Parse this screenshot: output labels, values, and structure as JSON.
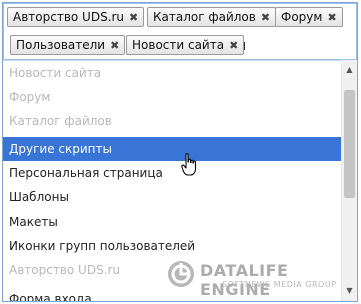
{
  "selected_tags": [
    {
      "label": "Авторство UDS.ru",
      "remove_glyph": "✖"
    },
    {
      "label": "Каталог файлов",
      "remove_glyph": "✖"
    },
    {
      "label": "Форум",
      "remove_glyph": "✖"
    },
    {
      "label": "Пользователи",
      "remove_glyph": "✖"
    },
    {
      "label": "Новости сайта",
      "remove_glyph": "✖"
    }
  ],
  "search_input": {
    "value": "",
    "placeholder": ""
  },
  "options": [
    {
      "label": "Новости сайта",
      "state": "disabled"
    },
    {
      "label": "Форум",
      "state": "disabled"
    },
    {
      "label": "Каталог файлов",
      "state": "disabled"
    },
    {
      "label": "Другие скрипты",
      "state": "highlighted"
    },
    {
      "label": "Персональная страница",
      "state": "normal"
    },
    {
      "label": "Шаблоны",
      "state": "normal"
    },
    {
      "label": "Макеты",
      "state": "normal"
    },
    {
      "label": "Иконки групп пользователей",
      "state": "normal"
    },
    {
      "label": "Авторство UDS.ru",
      "state": "disabled"
    },
    {
      "label": "Форма входа",
      "state": "normal"
    }
  ],
  "watermark": {
    "title": "DATALIFE ENGINE",
    "subtitle": "SOFTNEWS MEDIA GROUP"
  },
  "colors": {
    "highlight": "#3875d7",
    "disabled_text": "#b8b8b8",
    "border": "#7aa7d6"
  },
  "icons": {
    "remove": "close-icon",
    "cursor": "hand-pointer-icon",
    "logo": "datalife-engine-logo"
  }
}
